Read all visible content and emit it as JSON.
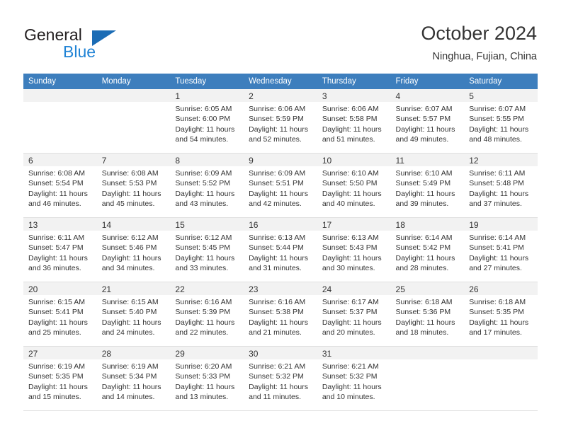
{
  "brand": {
    "name_part1": "General",
    "name_part2": "Blue",
    "triangle_color": "#1b6cb5",
    "blue_color": "#2083d5"
  },
  "header": {
    "title": "October 2024",
    "subtitle": "Ninghua, Fujian, China",
    "header_bg_color": "#3d7ebd",
    "header_text_color": "#ffffff"
  },
  "weekdays": [
    "Sunday",
    "Monday",
    "Tuesday",
    "Wednesday",
    "Thursday",
    "Friday",
    "Saturday"
  ],
  "weeks": [
    [
      {
        "day": "",
        "sunrise": "",
        "sunset": "",
        "daylight1": "",
        "daylight2": ""
      },
      {
        "day": "",
        "sunrise": "",
        "sunset": "",
        "daylight1": "",
        "daylight2": ""
      },
      {
        "day": "1",
        "sunrise": "Sunrise: 6:05 AM",
        "sunset": "Sunset: 6:00 PM",
        "daylight1": "Daylight: 11 hours",
        "daylight2": "and 54 minutes."
      },
      {
        "day": "2",
        "sunrise": "Sunrise: 6:06 AM",
        "sunset": "Sunset: 5:59 PM",
        "daylight1": "Daylight: 11 hours",
        "daylight2": "and 52 minutes."
      },
      {
        "day": "3",
        "sunrise": "Sunrise: 6:06 AM",
        "sunset": "Sunset: 5:58 PM",
        "daylight1": "Daylight: 11 hours",
        "daylight2": "and 51 minutes."
      },
      {
        "day": "4",
        "sunrise": "Sunrise: 6:07 AM",
        "sunset": "Sunset: 5:57 PM",
        "daylight1": "Daylight: 11 hours",
        "daylight2": "and 49 minutes."
      },
      {
        "day": "5",
        "sunrise": "Sunrise: 6:07 AM",
        "sunset": "Sunset: 5:55 PM",
        "daylight1": "Daylight: 11 hours",
        "daylight2": "and 48 minutes."
      }
    ],
    [
      {
        "day": "6",
        "sunrise": "Sunrise: 6:08 AM",
        "sunset": "Sunset: 5:54 PM",
        "daylight1": "Daylight: 11 hours",
        "daylight2": "and 46 minutes."
      },
      {
        "day": "7",
        "sunrise": "Sunrise: 6:08 AM",
        "sunset": "Sunset: 5:53 PM",
        "daylight1": "Daylight: 11 hours",
        "daylight2": "and 45 minutes."
      },
      {
        "day": "8",
        "sunrise": "Sunrise: 6:09 AM",
        "sunset": "Sunset: 5:52 PM",
        "daylight1": "Daylight: 11 hours",
        "daylight2": "and 43 minutes."
      },
      {
        "day": "9",
        "sunrise": "Sunrise: 6:09 AM",
        "sunset": "Sunset: 5:51 PM",
        "daylight1": "Daylight: 11 hours",
        "daylight2": "and 42 minutes."
      },
      {
        "day": "10",
        "sunrise": "Sunrise: 6:10 AM",
        "sunset": "Sunset: 5:50 PM",
        "daylight1": "Daylight: 11 hours",
        "daylight2": "and 40 minutes."
      },
      {
        "day": "11",
        "sunrise": "Sunrise: 6:10 AM",
        "sunset": "Sunset: 5:49 PM",
        "daylight1": "Daylight: 11 hours",
        "daylight2": "and 39 minutes."
      },
      {
        "day": "12",
        "sunrise": "Sunrise: 6:11 AM",
        "sunset": "Sunset: 5:48 PM",
        "daylight1": "Daylight: 11 hours",
        "daylight2": "and 37 minutes."
      }
    ],
    [
      {
        "day": "13",
        "sunrise": "Sunrise: 6:11 AM",
        "sunset": "Sunset: 5:47 PM",
        "daylight1": "Daylight: 11 hours",
        "daylight2": "and 36 minutes."
      },
      {
        "day": "14",
        "sunrise": "Sunrise: 6:12 AM",
        "sunset": "Sunset: 5:46 PM",
        "daylight1": "Daylight: 11 hours",
        "daylight2": "and 34 minutes."
      },
      {
        "day": "15",
        "sunrise": "Sunrise: 6:12 AM",
        "sunset": "Sunset: 5:45 PM",
        "daylight1": "Daylight: 11 hours",
        "daylight2": "and 33 minutes."
      },
      {
        "day": "16",
        "sunrise": "Sunrise: 6:13 AM",
        "sunset": "Sunset: 5:44 PM",
        "daylight1": "Daylight: 11 hours",
        "daylight2": "and 31 minutes."
      },
      {
        "day": "17",
        "sunrise": "Sunrise: 6:13 AM",
        "sunset": "Sunset: 5:43 PM",
        "daylight1": "Daylight: 11 hours",
        "daylight2": "and 30 minutes."
      },
      {
        "day": "18",
        "sunrise": "Sunrise: 6:14 AM",
        "sunset": "Sunset: 5:42 PM",
        "daylight1": "Daylight: 11 hours",
        "daylight2": "and 28 minutes."
      },
      {
        "day": "19",
        "sunrise": "Sunrise: 6:14 AM",
        "sunset": "Sunset: 5:41 PM",
        "daylight1": "Daylight: 11 hours",
        "daylight2": "and 27 minutes."
      }
    ],
    [
      {
        "day": "20",
        "sunrise": "Sunrise: 6:15 AM",
        "sunset": "Sunset: 5:41 PM",
        "daylight1": "Daylight: 11 hours",
        "daylight2": "and 25 minutes."
      },
      {
        "day": "21",
        "sunrise": "Sunrise: 6:15 AM",
        "sunset": "Sunset: 5:40 PM",
        "daylight1": "Daylight: 11 hours",
        "daylight2": "and 24 minutes."
      },
      {
        "day": "22",
        "sunrise": "Sunrise: 6:16 AM",
        "sunset": "Sunset: 5:39 PM",
        "daylight1": "Daylight: 11 hours",
        "daylight2": "and 22 minutes."
      },
      {
        "day": "23",
        "sunrise": "Sunrise: 6:16 AM",
        "sunset": "Sunset: 5:38 PM",
        "daylight1": "Daylight: 11 hours",
        "daylight2": "and 21 minutes."
      },
      {
        "day": "24",
        "sunrise": "Sunrise: 6:17 AM",
        "sunset": "Sunset: 5:37 PM",
        "daylight1": "Daylight: 11 hours",
        "daylight2": "and 20 minutes."
      },
      {
        "day": "25",
        "sunrise": "Sunrise: 6:18 AM",
        "sunset": "Sunset: 5:36 PM",
        "daylight1": "Daylight: 11 hours",
        "daylight2": "and 18 minutes."
      },
      {
        "day": "26",
        "sunrise": "Sunrise: 6:18 AM",
        "sunset": "Sunset: 5:35 PM",
        "daylight1": "Daylight: 11 hours",
        "daylight2": "and 17 minutes."
      }
    ],
    [
      {
        "day": "27",
        "sunrise": "Sunrise: 6:19 AM",
        "sunset": "Sunset: 5:35 PM",
        "daylight1": "Daylight: 11 hours",
        "daylight2": "and 15 minutes."
      },
      {
        "day": "28",
        "sunrise": "Sunrise: 6:19 AM",
        "sunset": "Sunset: 5:34 PM",
        "daylight1": "Daylight: 11 hours",
        "daylight2": "and 14 minutes."
      },
      {
        "day": "29",
        "sunrise": "Sunrise: 6:20 AM",
        "sunset": "Sunset: 5:33 PM",
        "daylight1": "Daylight: 11 hours",
        "daylight2": "and 13 minutes."
      },
      {
        "day": "30",
        "sunrise": "Sunrise: 6:21 AM",
        "sunset": "Sunset: 5:32 PM",
        "daylight1": "Daylight: 11 hours",
        "daylight2": "and 11 minutes."
      },
      {
        "day": "31",
        "sunrise": "Sunrise: 6:21 AM",
        "sunset": "Sunset: 5:32 PM",
        "daylight1": "Daylight: 11 hours",
        "daylight2": "and 10 minutes."
      },
      {
        "day": "",
        "sunrise": "",
        "sunset": "",
        "daylight1": "",
        "daylight2": ""
      },
      {
        "day": "",
        "sunrise": "",
        "sunset": "",
        "daylight1": "",
        "daylight2": ""
      }
    ]
  ]
}
